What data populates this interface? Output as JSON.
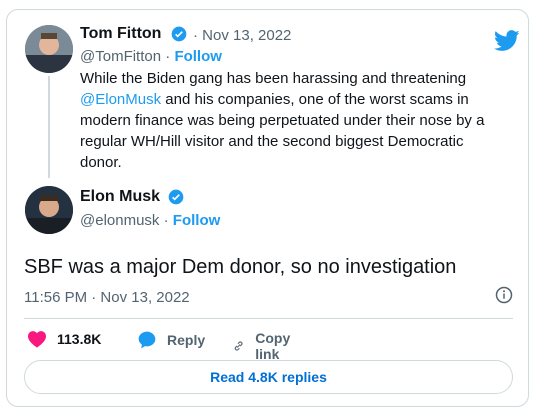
{
  "tweet_quote": {
    "author_name": "Tom Fitton",
    "date": "Nov 13, 2022",
    "handle": "@TomFitton",
    "follow_label": "Follow",
    "text_before_mention": "While the Biden gang has been harassing and threatening",
    "mention": "@ElonMusk",
    "text_after_mention_line1": "and his companies, one of the worst scams in",
    "text_line3": "modern finance was being perpetuated under their nose by a",
    "text_line4": "regular WH/Hill visitor and the second biggest Democratic",
    "text_line5": "donor."
  },
  "tweet_main": {
    "author_name": "Elon Musk",
    "handle": "@elonmusk",
    "follow_label": "Follow",
    "text": "SBF was a major Dem donor, so no investigation",
    "timestamp": "11:56 PM · Nov 13, 2022"
  },
  "actions": {
    "likes": "113.8K",
    "reply_label": "Reply",
    "copy_link_label": "Copy link"
  },
  "read_replies_label": "Read 4.8K replies",
  "colors": {
    "accent": "#1d9bf0",
    "like": "#f91880",
    "muted": "#536471",
    "border": "#cfd9de"
  },
  "icons": [
    "verified-badge-icon",
    "twitter-bird-icon",
    "info-icon",
    "heart-icon",
    "reply-bubble-icon",
    "link-icon"
  ]
}
